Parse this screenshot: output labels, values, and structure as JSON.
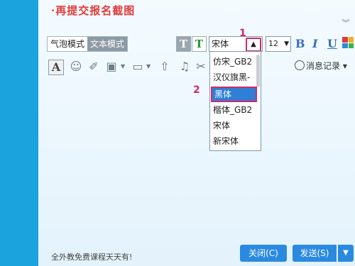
{
  "title": "·再提交报名截图",
  "mode_tabs": [
    "气泡模式",
    "文本模式"
  ],
  "toolbar": {
    "font_value": "宋体",
    "size_value": "12",
    "bold": "B",
    "italic": "I",
    "underline": "U",
    "history_label": "消息记录",
    "collapse": "︾"
  },
  "markers": {
    "m1": "1",
    "m2": "2"
  },
  "font_list": [
    "仿宋_GB2",
    "汉仪旗黑-",
    "黑体",
    "楷体_GB2",
    "宋体",
    "新宋体"
  ],
  "footer": {
    "ad_text": "全外教免费课程天天有!",
    "close_label": "关闭(C)",
    "send_label": "发送(S)"
  },
  "colors": {
    "accent_bar": "#1aa3dd",
    "highlight": "#d02a6a",
    "title_red": "#e23a3a",
    "button_blue": "#2a8ae0"
  }
}
